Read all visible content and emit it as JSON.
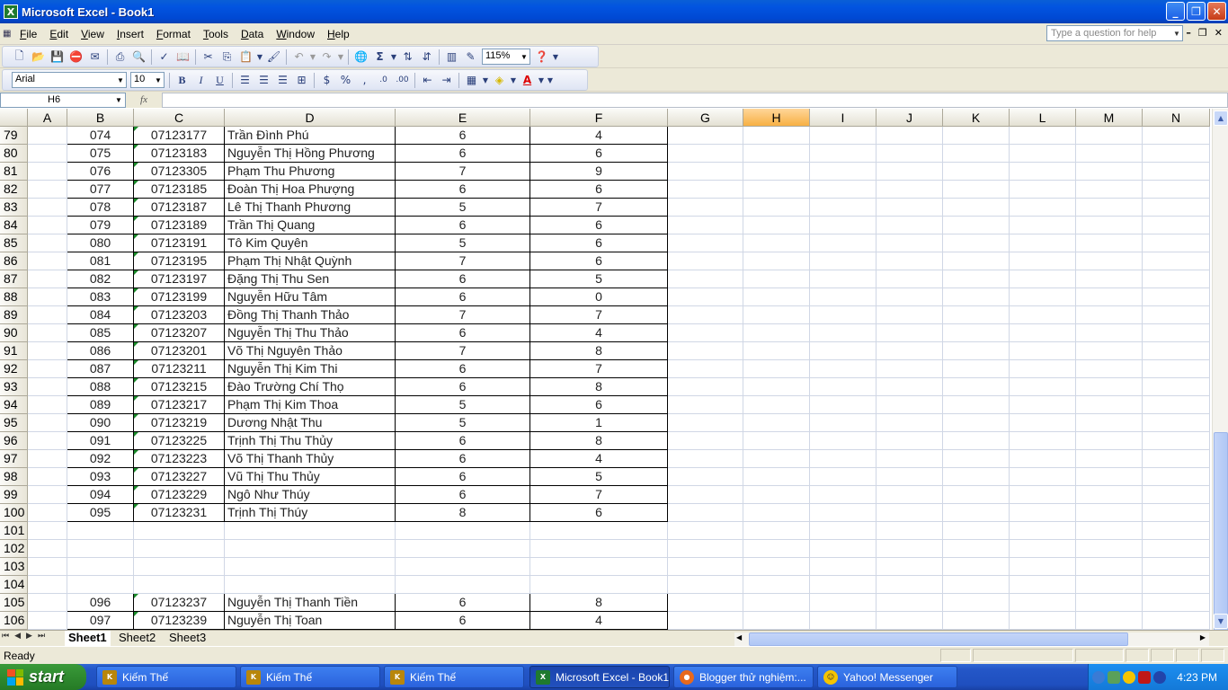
{
  "window": {
    "title": "Microsoft Excel - Book1",
    "app_icon": "X"
  },
  "menu": [
    "File",
    "Edit",
    "View",
    "Insert",
    "Format",
    "Tools",
    "Data",
    "Window",
    "Help"
  ],
  "help_box": {
    "placeholder": "Type a question for help"
  },
  "standard_toolbar": {
    "zoom": "115%"
  },
  "format_toolbar": {
    "font": "Arial",
    "size": "10"
  },
  "formula_bar": {
    "name_box": "H6",
    "fx": "fx",
    "content": ""
  },
  "columns": [
    "A",
    "B",
    "C",
    "D",
    "E",
    "F",
    "G",
    "H",
    "I",
    "J",
    "K",
    "L",
    "M",
    "N"
  ],
  "selected_column": "H",
  "rows": [
    {
      "num": "79",
      "b": "074",
      "c": "07123177",
      "d": "Trần Đình Phú",
      "e": "6",
      "f": "4"
    },
    {
      "num": "80",
      "b": "075",
      "c": "07123183",
      "d": "Nguyễn Thị Hồng Phương",
      "e": "6",
      "f": "6"
    },
    {
      "num": "81",
      "b": "076",
      "c": "07123305",
      "d": "Phạm Thu Phương",
      "e": "7",
      "f": "9"
    },
    {
      "num": "82",
      "b": "077",
      "c": "07123185",
      "d": "Đoàn Thị Hoa Phượng",
      "e": "6",
      "f": "6"
    },
    {
      "num": "83",
      "b": "078",
      "c": "07123187",
      "d": "Lê Thị Thanh Phương",
      "e": "5",
      "f": "7"
    },
    {
      "num": "84",
      "b": "079",
      "c": "07123189",
      "d": "Trần Thị Quang",
      "e": "6",
      "f": "6"
    },
    {
      "num": "85",
      "b": "080",
      "c": "07123191",
      "d": "Tô Kim Quyên",
      "e": "5",
      "f": "6"
    },
    {
      "num": "86",
      "b": "081",
      "c": "07123195",
      "d": "Phạm Thị Nhật Quỳnh",
      "e": "7",
      "f": "6"
    },
    {
      "num": "87",
      "b": "082",
      "c": "07123197",
      "d": "Đặng Thị Thu Sen",
      "e": "6",
      "f": "5"
    },
    {
      "num": "88",
      "b": "083",
      "c": "07123199",
      "d": "Nguyễn Hữu Tâm",
      "e": "6",
      "f": "0"
    },
    {
      "num": "89",
      "b": "084",
      "c": "07123203",
      "d": "Đồng Thị Thanh Thảo",
      "e": "7",
      "f": "7"
    },
    {
      "num": "90",
      "b": "085",
      "c": "07123207",
      "d": "Nguyễn Thị Thu Thảo",
      "e": "6",
      "f": "4"
    },
    {
      "num": "91",
      "b": "086",
      "c": "07123201",
      "d": "Võ Thị Nguyên Thảo",
      "e": "7",
      "f": "8"
    },
    {
      "num": "92",
      "b": "087",
      "c": "07123211",
      "d": "Nguyễn Thị Kim Thi",
      "e": "6",
      "f": "7"
    },
    {
      "num": "93",
      "b": "088",
      "c": "07123215",
      "d": "Đào Trường Chí Thọ",
      "e": "6",
      "f": "8"
    },
    {
      "num": "94",
      "b": "089",
      "c": "07123217",
      "d": "Phạm Thị Kim Thoa",
      "e": "5",
      "f": "6"
    },
    {
      "num": "95",
      "b": "090",
      "c": "07123219",
      "d": "Dương Nhật Thu",
      "e": "5",
      "f": "1"
    },
    {
      "num": "96",
      "b": "091",
      "c": "07123225",
      "d": "Trịnh Thị Thu Thủy",
      "e": "6",
      "f": "8"
    },
    {
      "num": "97",
      "b": "092",
      "c": "07123223",
      "d": "Võ Thị Thanh Thủy",
      "e": "6",
      "f": "4"
    },
    {
      "num": "98",
      "b": "093",
      "c": "07123227",
      "d": "Vũ Thị Thu Thủy",
      "e": "6",
      "f": "5"
    },
    {
      "num": "99",
      "b": "094",
      "c": "07123229",
      "d": "Ngô Như Thúy",
      "e": "6",
      "f": "7"
    },
    {
      "num": "100",
      "b": "095",
      "c": "07123231",
      "d": "Trịnh Thị Thúy",
      "e": "8",
      "f": "6"
    },
    {
      "num": "101",
      "b": "",
      "c": "",
      "d": "",
      "e": "",
      "f": ""
    },
    {
      "num": "102",
      "b": "",
      "c": "",
      "d": "",
      "e": "",
      "f": ""
    },
    {
      "num": "103",
      "b": "",
      "c": "",
      "d": "",
      "e": "",
      "f": ""
    },
    {
      "num": "104",
      "b": "",
      "c": "",
      "d": "",
      "e": "",
      "f": ""
    },
    {
      "num": "105",
      "b": "096",
      "c": "07123237",
      "d": "Nguyễn Thị Thanh Tiền",
      "e": "6",
      "f": "8"
    },
    {
      "num": "106",
      "b": "097",
      "c": "07123239",
      "d": "Nguyễn Thị Toan",
      "e": "6",
      "f": "4"
    }
  ],
  "sheets": [
    "Sheet1",
    "Sheet2",
    "Sheet3"
  ],
  "active_sheet": "Sheet1",
  "status": "Ready",
  "taskbar": {
    "start": "start",
    "tasks": [
      {
        "label": "Kiếm Thế",
        "icon": "game-icon",
        "active": false
      },
      {
        "label": "Kiếm Thế",
        "icon": "game-icon",
        "active": false
      },
      {
        "label": "Kiếm Thế",
        "icon": "game-icon",
        "active": false
      },
      {
        "label": "Microsoft Excel - Book1",
        "icon": "excel-icon",
        "active": true
      },
      {
        "label": "Blogger thử nghiệm:...",
        "icon": "firefox-icon",
        "active": false
      },
      {
        "label": "Yahoo! Messenger",
        "icon": "yahoo-messenger-icon",
        "active": false
      }
    ],
    "clock": "4:23 PM"
  },
  "colors": {
    "title_bar": "#0054e3",
    "taskbar": "#245edb",
    "start": "#3c9a3c",
    "selected_header": "#f9b443",
    "text_marker": "#1a8b2a"
  }
}
